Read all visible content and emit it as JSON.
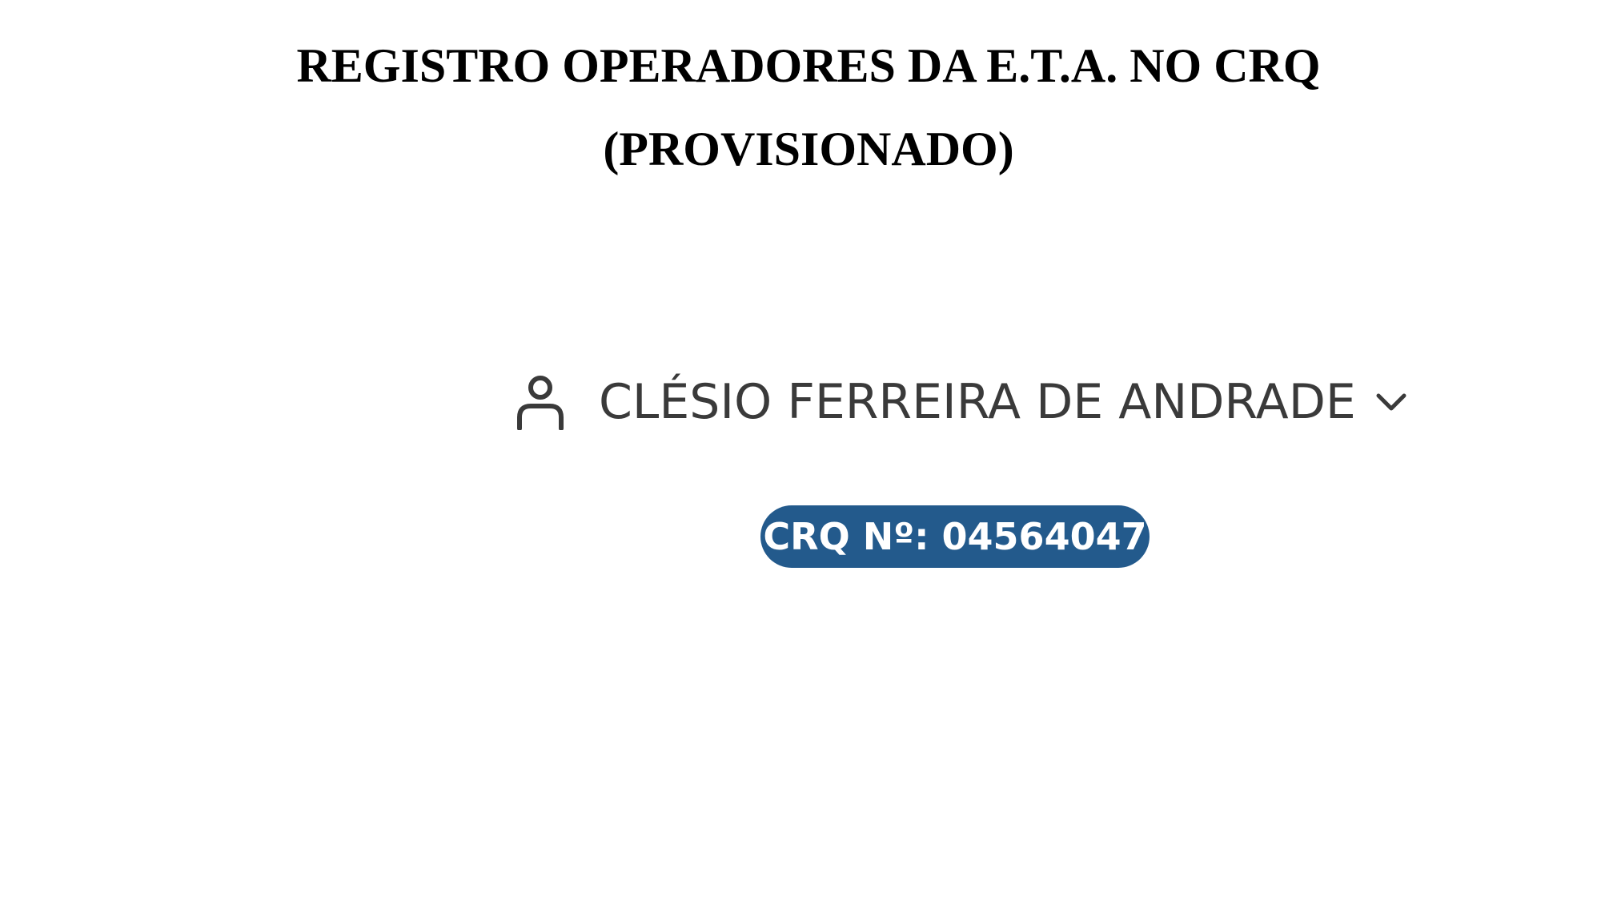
{
  "document": {
    "title_line_1": "REGISTRO OPERADORES DA E.T.A. NO CRQ",
    "title_line_2": "(PROVISIONADO)"
  },
  "user": {
    "icon": "user-icon",
    "name": "CLÉSIO FERREIRA DE ANDRADE",
    "dropdown_icon": "chevron-down-icon"
  },
  "badge": {
    "text": "CRQ Nº: 04564047",
    "color": "#235a8c"
  }
}
